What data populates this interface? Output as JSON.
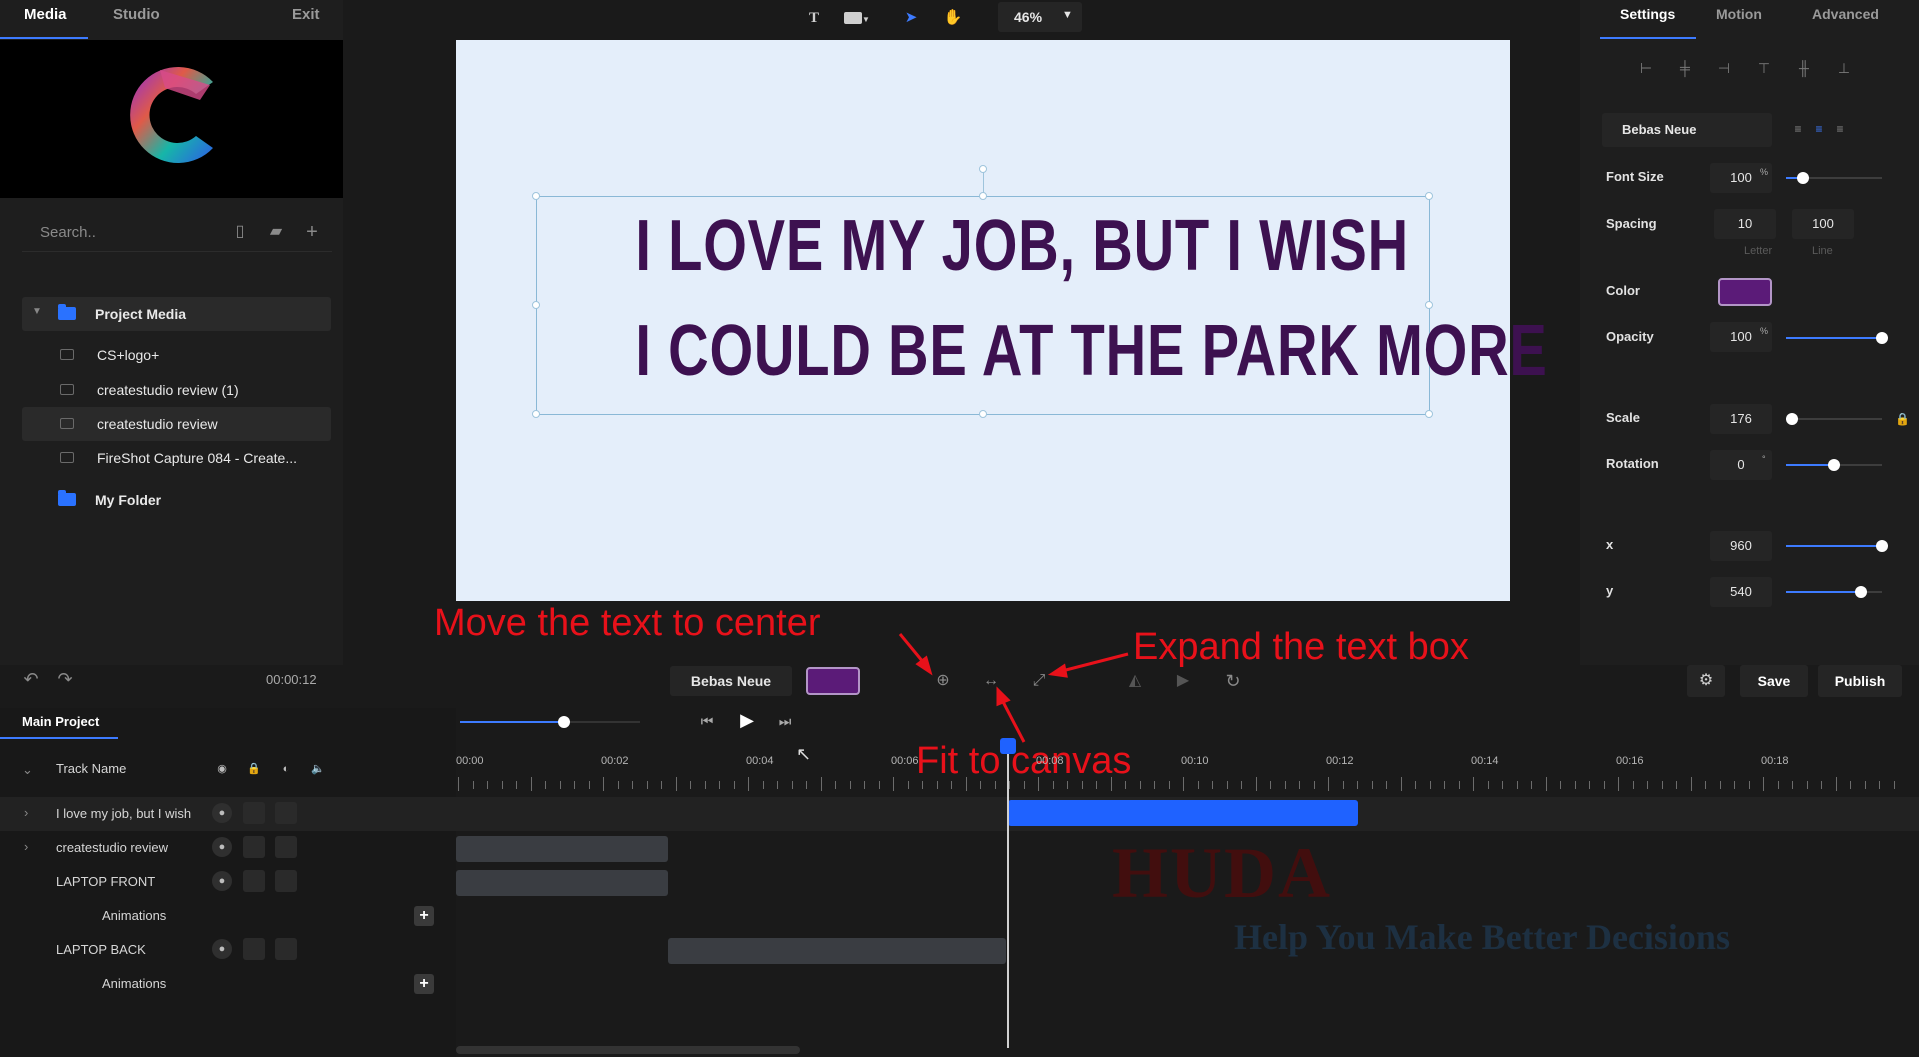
{
  "left_panel": {
    "tabs": [
      {
        "label": "Media"
      },
      {
        "label": "Studio"
      },
      {
        "label": "Exit"
      }
    ],
    "search_placeholder": "Search..",
    "tree": [
      {
        "label": "Project Media",
        "type": "folder"
      },
      {
        "label": "CS+logo+",
        "type": "file"
      },
      {
        "label": "createstudio review (1)",
        "type": "file"
      },
      {
        "label": "createstudio review",
        "type": "file"
      },
      {
        "label": "FireShot Capture 084 - Create...",
        "type": "file"
      },
      {
        "label": "My Folder",
        "type": "folder"
      }
    ]
  },
  "toolbar": {
    "zoom": "46%"
  },
  "canvas": {
    "background": "#e4eefa",
    "text_color": "#3d1150",
    "line1": "I LOVE MY JOB, BUT I WISH",
    "line2": "I COULD BE AT THE PARK MORE"
  },
  "right_panel": {
    "tabs": [
      {
        "label": "Settings"
      },
      {
        "label": "Motion"
      },
      {
        "label": "Advanced"
      }
    ],
    "font": "Bebas Neue",
    "font_size_label": "Font Size",
    "font_size": "100",
    "font_size_unit": "%",
    "spacing_label": "Spacing",
    "letter_spacing": "10",
    "line_spacing": "100",
    "letter_sub": "Letter",
    "line_sub": "Line",
    "color_label": "Color",
    "color_value": "#5b1b78",
    "opacity_label": "Opacity",
    "opacity": "100",
    "opacity_unit": "%",
    "scale_label": "Scale",
    "scale": "176",
    "rotation_label": "Rotation",
    "rotation": "0",
    "rotation_unit": "°",
    "x_label": "x",
    "x": "960",
    "y_label": "y",
    "y": "540",
    "sliders": {
      "font_size": 0.18,
      "opacity": 1.0,
      "scale": 0.06,
      "rotation": 0.5,
      "x": 1.0,
      "y": 0.78
    }
  },
  "control_bar": {
    "time": "00:00:12",
    "font": "Bebas Neue",
    "save": "Save",
    "publish": "Publish",
    "volume_level": 0.58
  },
  "annotations": {
    "center": "Move the text to center",
    "expand": "Expand the text box",
    "fit": "Fit to canvas"
  },
  "timeline": {
    "tab": "Main Project",
    "track_header": "Track Name",
    "ruler": [
      "00:00",
      "00:02",
      "00:04",
      "00:06",
      "00:08",
      "00:10",
      "00:12",
      "00:14",
      "00:16",
      "00:18"
    ],
    "tracks": [
      {
        "name": "I love my job, but I wish"
      },
      {
        "name": "createstudio review"
      },
      {
        "name": "LAPTOP FRONT"
      },
      {
        "name": "Animations"
      },
      {
        "name": "LAPTOP BACK"
      },
      {
        "name": "Animations"
      }
    ]
  },
  "watermark": {
    "line1": "HUDA",
    "line2": "Help You Make Better Decisions"
  }
}
